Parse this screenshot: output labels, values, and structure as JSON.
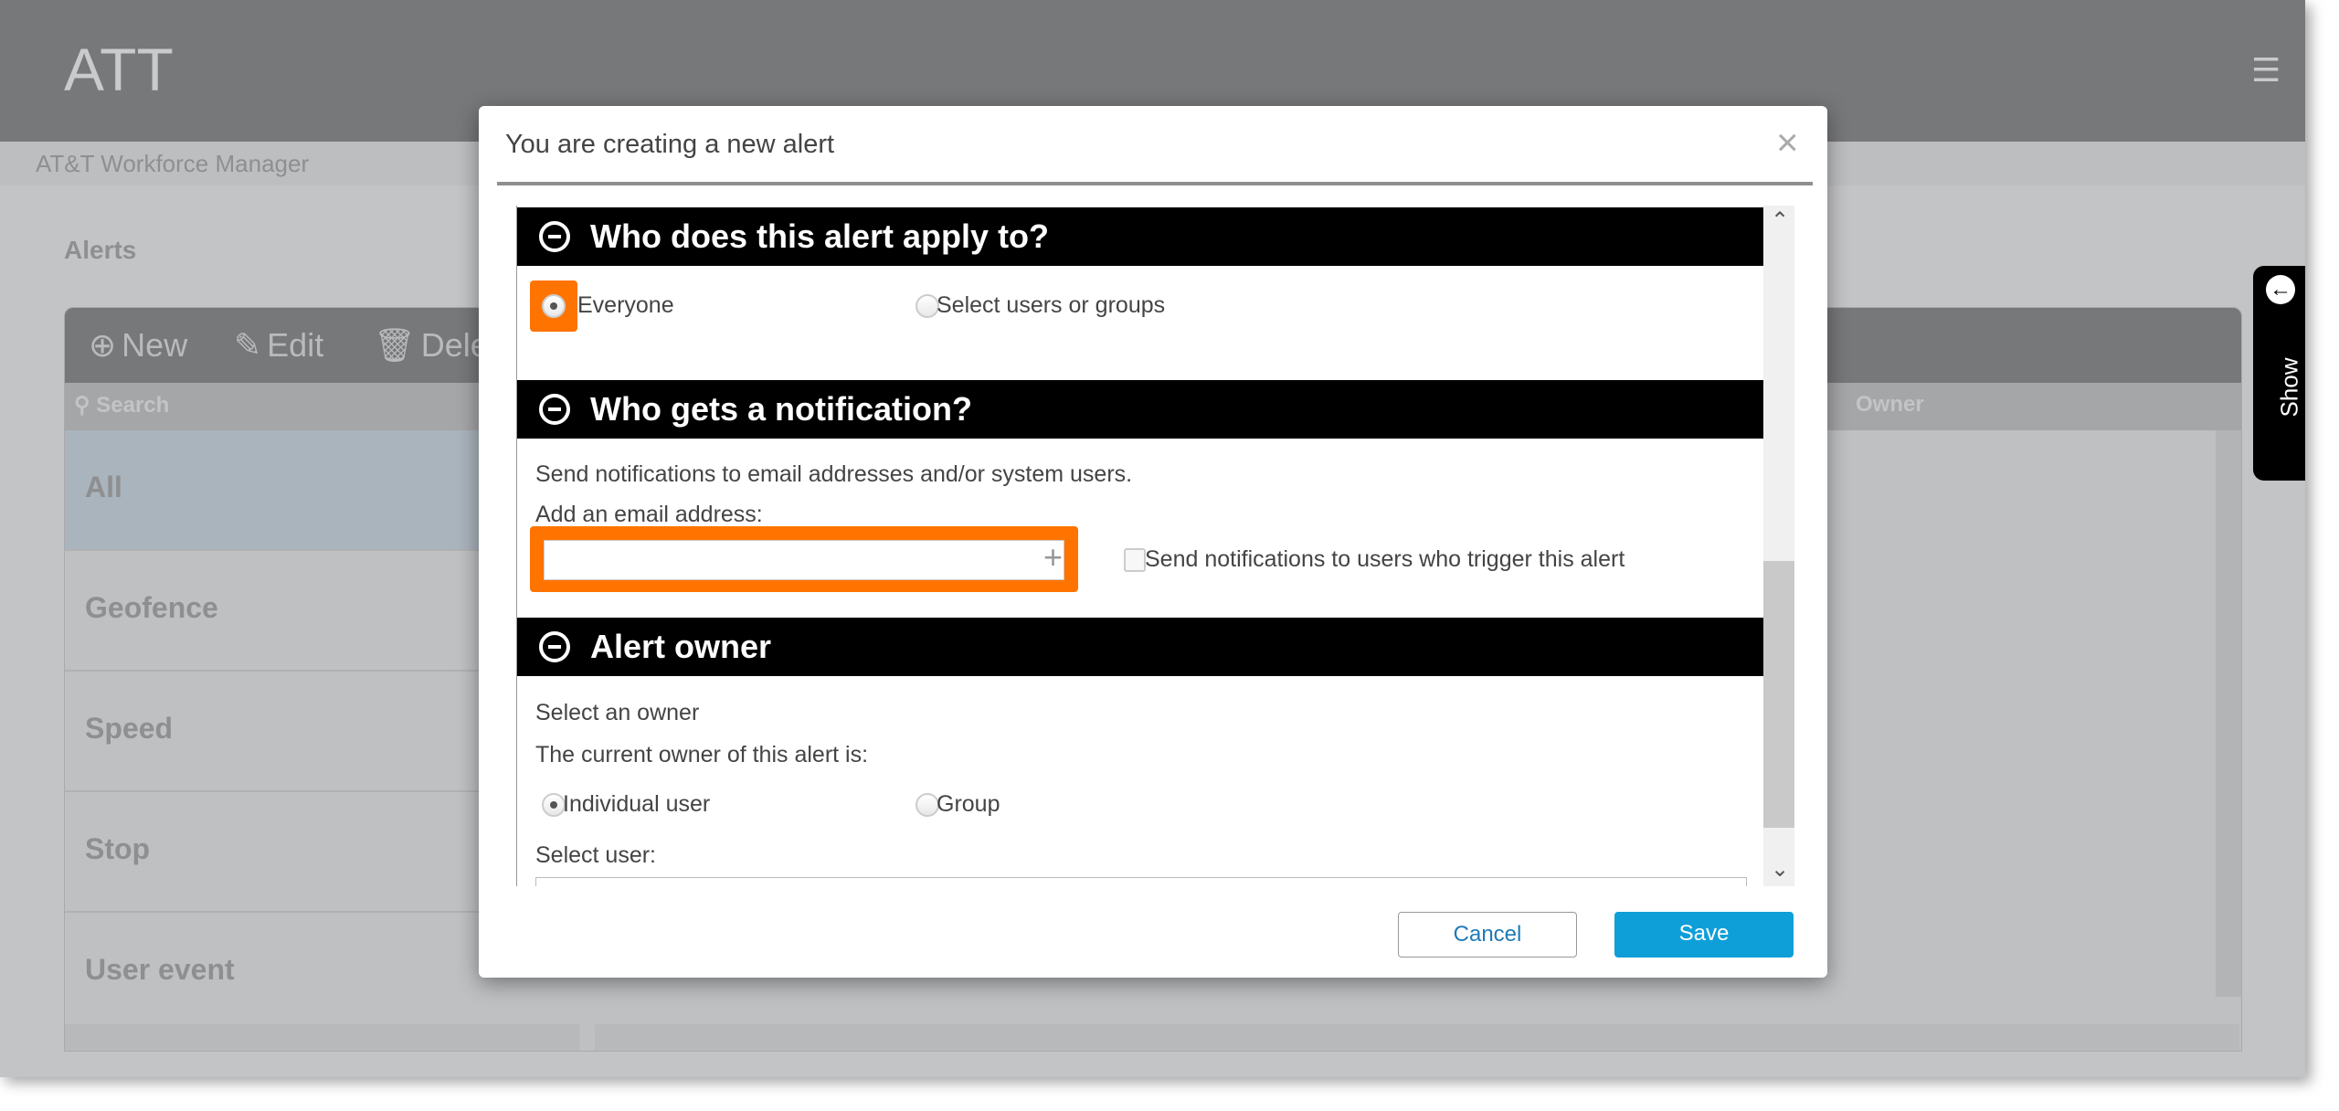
{
  "app": {
    "title": "ATT",
    "subtitle": "AT&T Workforce Manager",
    "menu_icon": "hamburger-icon"
  },
  "page": {
    "heading": "Alerts"
  },
  "toolbar": {
    "new": "New",
    "edit": "Edit",
    "delete": "Dele"
  },
  "list": {
    "search_placeholder": "Search",
    "owner_header": "Owner",
    "items": [
      "All",
      "Geofence",
      "Speed",
      "Stop",
      "User event"
    ],
    "selected": "All"
  },
  "side_tab": {
    "label": "Show"
  },
  "modal": {
    "title": "You are creating a new alert",
    "sections": [
      {
        "title": "Who does this alert apply to?",
        "options": [
          "Everyone",
          "Select users or groups"
        ],
        "selected": "Everyone"
      },
      {
        "title": "Who gets a notification?",
        "description": "Send notifications to email addresses and/or system users.",
        "email_label": "Add an email address:",
        "email_value": "",
        "checkbox_label": "Send notifications to users who trigger this alert",
        "checkbox_checked": false
      },
      {
        "title": "Alert owner",
        "line1": "Select an owner",
        "line2": "The current owner of this alert is:",
        "options": [
          "Individual user",
          "Group"
        ],
        "selected": "Individual user",
        "select_label": "Select user:"
      }
    ],
    "cancel": "Cancel",
    "save": "Save"
  },
  "colors": {
    "highlight": "#ff7300",
    "save": "#0f9fd8",
    "section_header": "#000000"
  }
}
